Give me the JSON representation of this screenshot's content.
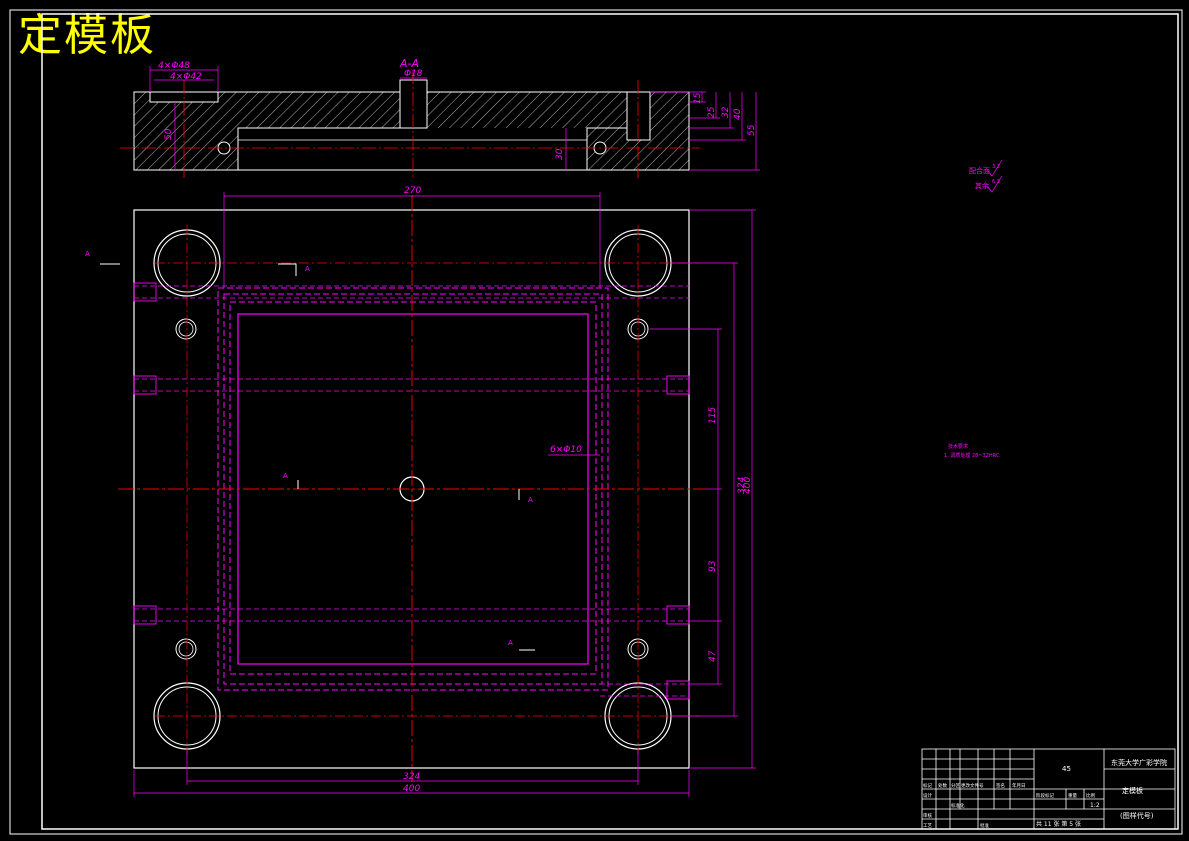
{
  "title": "定模板",
  "section_view": {
    "label": "A-A",
    "dims": {
      "d_top1": "4×Φ48",
      "d_top2": "4×Φ42",
      "d_center": "Φ18",
      "h50": "50",
      "h30": "30",
      "r15": "15",
      "r25": "25",
      "r32": "32",
      "r40": "40",
      "r55": "55"
    }
  },
  "plan_view": {
    "dim_270": "270",
    "dim_324_h": "324",
    "dim_400_h": "400",
    "dim_115": "115",
    "dim_93": "93",
    "dim_47": "47",
    "dim_324_v": "324",
    "dim_400_v": "400",
    "hole_note": "6×Φ10",
    "section_marks": [
      "A",
      "A",
      "A",
      "A",
      "A",
      "A"
    ]
  },
  "surface_notes": {
    "line1": "配合面",
    "line2": "其余",
    "val1": "3.2",
    "val2": "6.3"
  },
  "small_note": {
    "line1": "技术要求",
    "line2": "1. 调质处理 28~32HRC"
  },
  "title_block": {
    "material": "45",
    "school": "东莞大学广彩学院",
    "part_name": "定模板",
    "drawing_no": "(图样代号)",
    "scale": "1:2",
    "sheet": "共 11 张 第 5 张",
    "rows": [
      "标记",
      "处数",
      "分区",
      "更改文件号",
      "签名",
      "年月日",
      "设计",
      "标准化",
      "审核",
      "工艺",
      "批准",
      "阶段标记",
      "重量",
      "比例"
    ]
  },
  "colors": {
    "background": "#000000",
    "outline": "#ffffff",
    "dimension": "#ff00ff",
    "centerline": "#ff0000",
    "title": "#ffff00",
    "hatch": "#ffffff"
  }
}
